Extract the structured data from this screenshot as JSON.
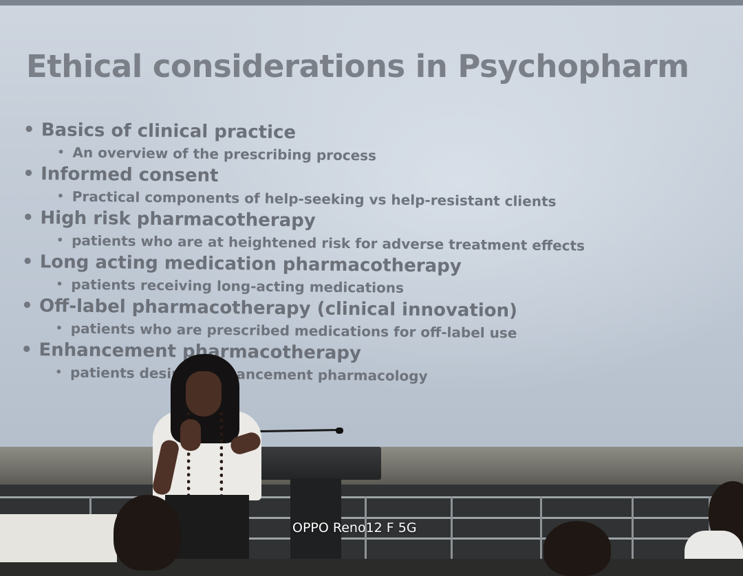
{
  "slide": {
    "title": "Ethical considerations in Psychopharm",
    "items": [
      {
        "heading": "Basics of clinical practice",
        "sub": "An overview of the prescribing process"
      },
      {
        "heading": "Informed consent",
        "sub": "Practical components of help-seeking vs help-resistant clients"
      },
      {
        "heading": "High risk pharmacotherapy",
        "sub": "patients who are at heightened risk for adverse treatment effects"
      },
      {
        "heading": "Long acting medication pharmacotherapy",
        "sub": "patients receiving long-acting medications"
      },
      {
        "heading": "Off-label pharmacotherapy (clinical innovation)",
        "sub": "patients who are prescribed medications for off-label use"
      },
      {
        "heading": "Enhancement pharmacotherapy",
        "sub": "patients desiring enhancement pharmacology"
      }
    ]
  },
  "photo": {
    "watermark": "OPPO Reno12 F 5G"
  },
  "colors": {
    "screen": "#c3ccd7",
    "slide_text": "#6b7079",
    "stage": "#303233"
  }
}
